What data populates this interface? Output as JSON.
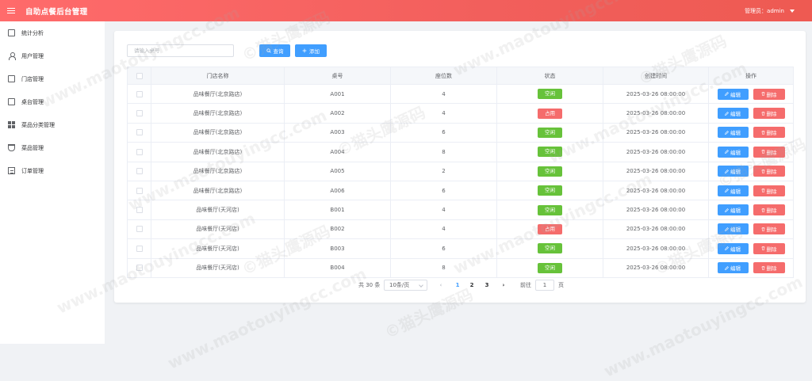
{
  "header": {
    "title": "自助点餐后台管理",
    "user": "管理员：admin"
  },
  "sidebar": {
    "items": [
      {
        "label": "统计分析",
        "icon": "monitor-icon"
      },
      {
        "label": "用户管理",
        "icon": "user-icon"
      },
      {
        "label": "门店管理",
        "icon": "shop-icon"
      },
      {
        "label": "桌台管理",
        "icon": "table-icon"
      },
      {
        "label": "菜品分类管理",
        "icon": "grid-icon"
      },
      {
        "label": "菜品管理",
        "icon": "dish-icon"
      },
      {
        "label": "订单管理",
        "icon": "order-icon"
      }
    ]
  },
  "search": {
    "placeholder": "请输入桌号",
    "query_label": "查询",
    "add_label": "添加"
  },
  "table": {
    "columns": [
      "门店名称",
      "桌号",
      "座位数",
      "状态",
      "创建时间",
      "操作"
    ],
    "edit_label": "编辑",
    "delete_label": "删除",
    "rows": [
      {
        "store": "品味餐厅(北京路店)",
        "table_no": "A001",
        "seats": "4",
        "status": "空闲",
        "created": "2025-03-26 08:00:00"
      },
      {
        "store": "品味餐厅(北京路店)",
        "table_no": "A002",
        "seats": "4",
        "status": "占用",
        "created": "2025-03-26 08:00:00"
      },
      {
        "store": "品味餐厅(北京路店)",
        "table_no": "A003",
        "seats": "6",
        "status": "空闲",
        "created": "2025-03-26 08:00:00"
      },
      {
        "store": "品味餐厅(北京路店)",
        "table_no": "A004",
        "seats": "8",
        "status": "空闲",
        "created": "2025-03-26 08:00:00"
      },
      {
        "store": "品味餐厅(北京路店)",
        "table_no": "A005",
        "seats": "2",
        "status": "空闲",
        "created": "2025-03-26 08:00:00"
      },
      {
        "store": "品味餐厅(北京路店)",
        "table_no": "A006",
        "seats": "6",
        "status": "空闲",
        "created": "2025-03-26 08:00:00"
      },
      {
        "store": "品味餐厅(天河店)",
        "table_no": "B001",
        "seats": "4",
        "status": "空闲",
        "created": "2025-03-26 08:00:00"
      },
      {
        "store": "品味餐厅(天河店)",
        "table_no": "B002",
        "seats": "4",
        "status": "占用",
        "created": "2025-03-26 08:00:00"
      },
      {
        "store": "品味餐厅(天河店)",
        "table_no": "B003",
        "seats": "6",
        "status": "空闲",
        "created": "2025-03-26 08:00:00"
      },
      {
        "store": "品味餐厅(天河店)",
        "table_no": "B004",
        "seats": "8",
        "status": "空闲",
        "created": "2025-03-26 08:00:00"
      }
    ]
  },
  "pagination": {
    "total": "共 30 条",
    "page_size": "10条/页",
    "pages": [
      "1",
      "2",
      "3"
    ],
    "current": "1",
    "goto_label": "前往",
    "goto_value": "1",
    "page_unit": "页"
  },
  "watermark": {
    "text_cn": "©猫头鹰源码",
    "text_url": "www.maotouyingcc.com"
  },
  "colors": {
    "header": "#f25f5c",
    "primary": "#409eff",
    "free": "#67c23a",
    "occupied": "#f56c6c"
  }
}
